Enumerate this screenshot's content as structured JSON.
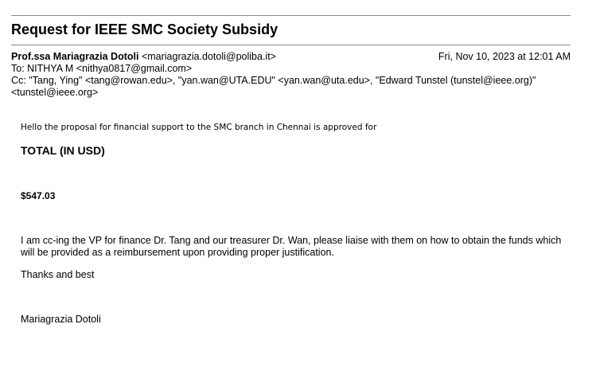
{
  "email": {
    "subject": "Request for IEEE SMC Society Subsidy",
    "from_name": "Prof.ssa Mariagrazia Dotoli",
    "from_email": " <mariagrazia.dotoli@poliba.it>",
    "date": "Fri, Nov 10, 2023 at 12:01 AM",
    "to": "To: NITHYA M <nithya0817@gmail.com>",
    "cc": "Cc: \"Tang, Ying\" <tang@rowan.edu>, \"yan.wan@UTA.EDU\" <yan.wan@uta.edu>, \"Edward Tunstel (tunstel@ieee.org)\" <tunstel@ieee.org>"
  },
  "body": {
    "greeting": "Hello the proposal for financial support to the SMC branch in Chennai is approved for",
    "total_label": "TOTAL (IN USD)",
    "amount": "$547.03",
    "paragraph": "I am cc-ing the VP for finance Dr. Tang and our treasurer Dr. Wan, please liaise with them on how to obtain the funds which will be provided as a reimbursement upon providing proper justification.",
    "thanks": "Thanks and best",
    "signature": "Mariagrazia Dotoli"
  }
}
